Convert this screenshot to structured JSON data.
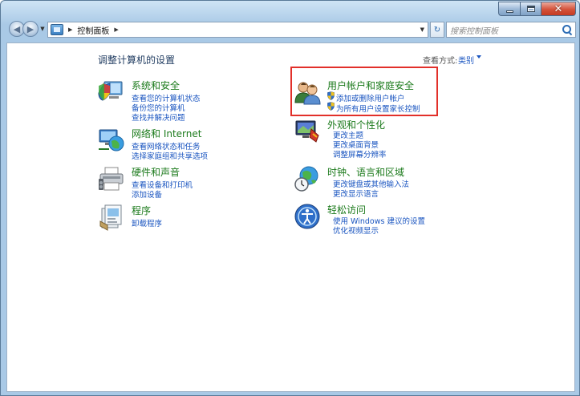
{
  "titlebar": {
    "minimize_glyph": "",
    "close_glyph": "✕"
  },
  "navbar": {
    "breadcrumb": [
      "控制面板"
    ],
    "search_placeholder": "搜索控制面板"
  },
  "page": {
    "title": "调整计算机的设置",
    "view_by_label": "查看方式:",
    "view_by_value": "类别"
  },
  "categories": [
    {
      "id": "system-security",
      "title": "系统和安全",
      "icon": "shield-pc-icon",
      "links": [
        "查看您的计算机状态",
        "备份您的计算机",
        "查找并解决问题"
      ]
    },
    {
      "id": "network-internet",
      "title": "网络和 Internet",
      "icon": "globe-network-icon",
      "links": [
        "查看网络状态和任务",
        "选择家庭组和共享选项"
      ]
    },
    {
      "id": "hardware-sound",
      "title": "硬件和声音",
      "icon": "printer-icon",
      "links": [
        "查看设备和打印机",
        "添加设备"
      ]
    },
    {
      "id": "programs",
      "title": "程序",
      "icon": "programs-icon",
      "links": [
        "卸载程序"
      ]
    },
    {
      "id": "user-accounts",
      "title": "用户帐户和家庭安全",
      "icon": "users-icon",
      "links": [
        "添加或删除用户帐户",
        "为所有用户设置家长控制"
      ],
      "highlighted": true
    },
    {
      "id": "appearance",
      "title": "外观和个性化",
      "icon": "appearance-icon",
      "links": [
        "更改主题",
        "更改桌面背景",
        "调整屏幕分辨率"
      ]
    },
    {
      "id": "clock-region",
      "title": "时钟、语言和区域",
      "icon": "clock-globe-icon",
      "links": [
        "更改键盘或其他输入法",
        "更改显示语言"
      ]
    },
    {
      "id": "ease-of-access",
      "title": "轻松访问",
      "icon": "ease-of-access-icon",
      "links": [
        "使用 Windows 建议的设置",
        "优化视频显示"
      ]
    }
  ],
  "colors": {
    "category_title": "#1b7a1b",
    "link": "#1a55c0",
    "highlight_border": "#e2302a"
  }
}
